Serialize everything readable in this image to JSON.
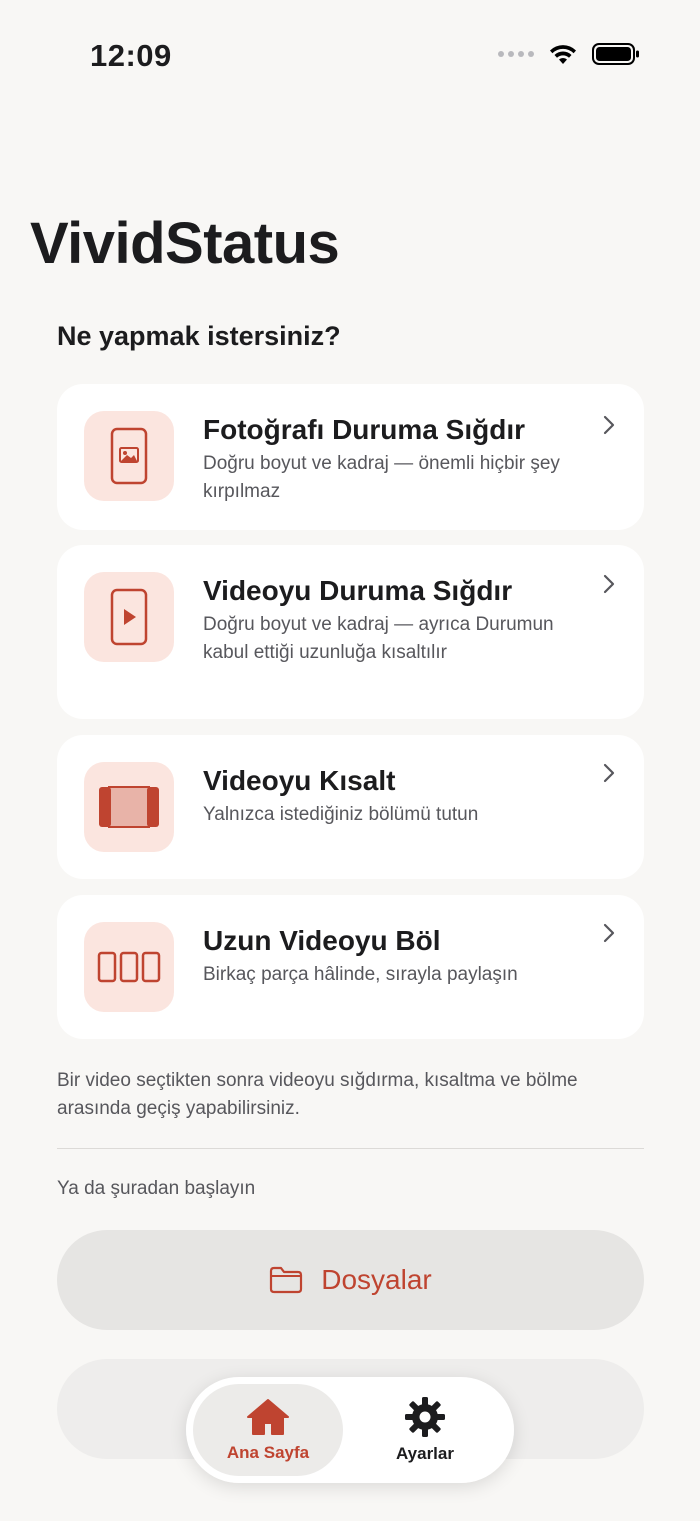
{
  "status_bar": {
    "time": "12:09"
  },
  "app": {
    "title": "VividStatus"
  },
  "main": {
    "section_title": "Ne yapmak istersiniz?",
    "options": [
      {
        "title": "Fotoğrafı Duruma Sığdır",
        "description": "Doğru boyut ve kadraj — önemli hiçbir şey kırpılmaz",
        "icon": "photo-phone-icon"
      },
      {
        "title": "Videoyu Duruma Sığdır",
        "description": "Doğru boyut ve kadraj — ayrıca Durumun kabul ettiği uzunluğa kısaltılır",
        "icon": "video-phone-icon"
      },
      {
        "title": "Videoyu Kısalt",
        "description": "Yalnızca istediğiniz bölümü tutun",
        "icon": "trim-icon"
      },
      {
        "title": "Uzun Videoyu Böl",
        "description": "Birkaç parça hâlinde, sırayla paylaşın",
        "icon": "split-icon"
      }
    ],
    "info_text": "Bir video seçtikten sonra videoyu sığdırma, kısaltma ve bölme arasında geçiş yapabilirsiniz.",
    "start_label": "Ya da şuradan başlayın",
    "files_button": "Dosyalar"
  },
  "tab_bar": {
    "tabs": [
      {
        "label": "Ana Sayfa",
        "icon": "house-icon",
        "active": true
      },
      {
        "label": "Ayarlar",
        "icon": "gear-icon",
        "active": false
      }
    ]
  },
  "colors": {
    "accent": "#bf4430",
    "icon_bg": "#fbe5df",
    "background": "#f8f7f5"
  }
}
